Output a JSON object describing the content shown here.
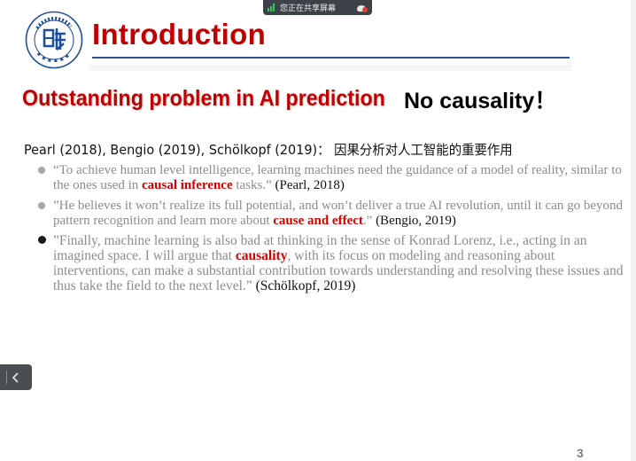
{
  "share_bar": {
    "text": "您正在共享屏幕",
    "stop_icon": "stop-share-icon"
  },
  "slide": {
    "logo_icon": "fudan-university-logo",
    "title": "Introduction",
    "subtitle_left": "Outstanding problem in AI prediction",
    "subtitle_right": "No causality！",
    "refs_line": "Pearl (2018), Bengio (2019), Schölkopf (2019)： 因果分析对人工智能的重要作用",
    "quotes": [
      {
        "pre": "“To achieve human level intelligence, learning machines need the guidance of a model of reality, similar to the ones used in ",
        "highlight": "causal inference",
        "post": " tasks.” ",
        "cite": "(Pearl, 2018)"
      },
      {
        "pre": " ”He believes it won’t realize its full potential, and won’t deliver a true AI revolution, until it can go beyond pattern recognition and learn more about ",
        "highlight": "cause and effect",
        "post": ".” ",
        "cite": " (Bengio, 2019)"
      },
      {
        "pre": " ”Finally, machine learning is also bad at thinking in the sense of Konrad Lorenz, i.e., acting in an imagined space. I will argue that ",
        "highlight": "causality",
        "post": ", with its focus on modeling and reasoning about interventions, can make a substantial contribution towards understanding and resolving these issues and thus take the field to the next  level.” ",
        "cite": "(Schölkopf, 2019)"
      }
    ],
    "page_number": "3"
  },
  "nav": {
    "prev_icon": "chevron-left-icon"
  },
  "colors": {
    "title_red": "#c00000",
    "highlight_red": "#d40000",
    "rule_blue": "#2f4f8f",
    "quote_gray": "#8c8c8c"
  }
}
